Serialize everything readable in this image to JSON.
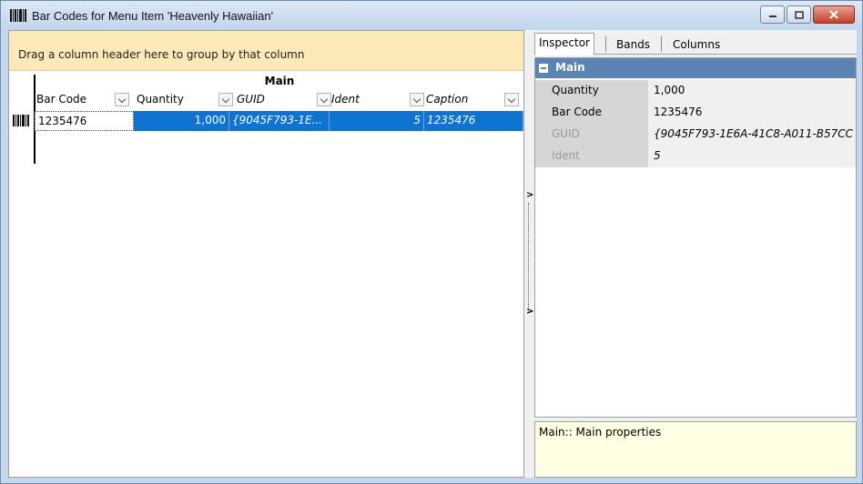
{
  "window": {
    "title": "Bar Codes for Menu Item 'Heavenly Hawaiian'",
    "icon": "barcode-icon"
  },
  "grid": {
    "group_hint": "Drag a column header here to group by that column",
    "band": "Main",
    "columns": [
      {
        "label": "Bar Code"
      },
      {
        "label": "Quantity"
      },
      {
        "label": "GUID"
      },
      {
        "label": "Ident"
      },
      {
        "label": "Caption"
      }
    ],
    "rows": [
      {
        "bar_code": "1235476",
        "quantity": "1,000",
        "guid": "{9045F793-1E...",
        "ident": "5",
        "caption": "1235476"
      }
    ],
    "selection_color": "#0f73d2"
  },
  "tabs": [
    {
      "label": "Inspector",
      "active": true
    },
    {
      "label": "Bands"
    },
    {
      "label": "Columns"
    }
  ],
  "inspector": {
    "category": "Main",
    "properties": [
      {
        "name": "Quantity",
        "value": "1,000"
      },
      {
        "name": "Bar Code",
        "value": "1235476"
      },
      {
        "name": "GUID",
        "value": "{9045F793-1E6A-41C8-A011-B57CC"
      },
      {
        "name": "Ident",
        "value": "5"
      }
    ],
    "description": "Main:: Main properties"
  }
}
